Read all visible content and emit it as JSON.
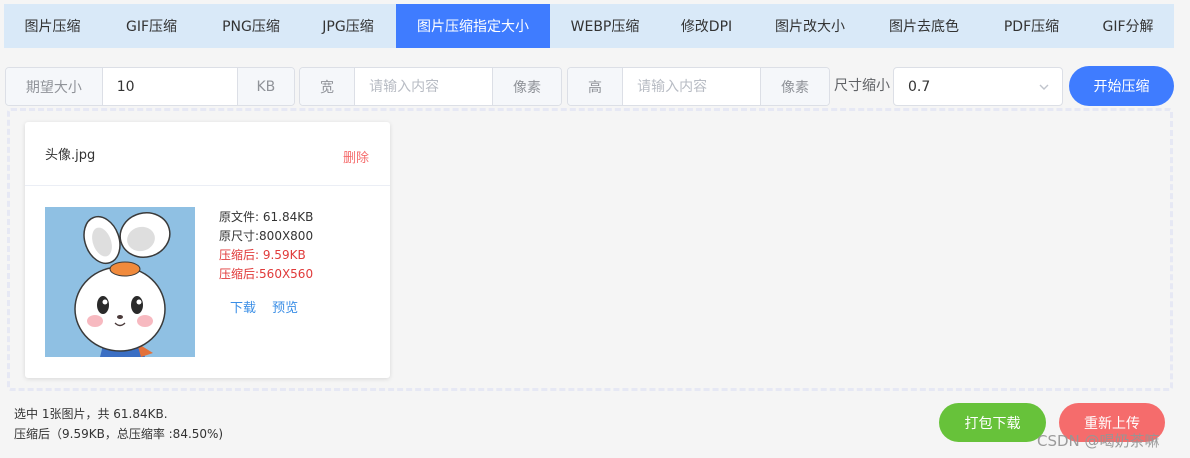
{
  "tabs": [
    {
      "label": "图片压缩"
    },
    {
      "label": "GIF压缩"
    },
    {
      "label": "PNG压缩"
    },
    {
      "label": "JPG压缩"
    },
    {
      "label": "图片压缩指定大小"
    },
    {
      "label": "WEBP压缩"
    },
    {
      "label": "修改DPI"
    },
    {
      "label": "图片改大小"
    },
    {
      "label": "图片去底色"
    },
    {
      "label": "PDF压缩"
    },
    {
      "label": "GIF分解"
    }
  ],
  "active_tab": "图片压缩指定大小",
  "options": {
    "size_label": "期望大小",
    "size_value": "10",
    "size_unit": "KB",
    "width_label": "宽",
    "width_placeholder": "请输入内容",
    "width_unit": "像素",
    "height_label": "高",
    "height_placeholder": "请输入内容",
    "height_unit": "像素",
    "scale_label": "尺寸缩小",
    "scale_value": "0.7",
    "start_button": "开始压缩"
  },
  "file_card": {
    "file_name": "头像.jpg",
    "delete_label": "删除",
    "original_file": "原文件: 61.84KB",
    "original_dims": "原尺寸:800X800",
    "compressed_size": "压缩后: 9.59KB",
    "compressed_dims": "压缩后:560X560",
    "download_label": "下载",
    "preview_label": "预览"
  },
  "footer": {
    "summary_line1": "选中 1张图片，共 61.84KB.",
    "summary_line2": "压缩后（9.59KB，总压缩率 :84.50%)",
    "pack_download": "打包下载",
    "reupload": "重新上传",
    "watermark": "CSDN @喝奶茶嘛"
  },
  "colors": {
    "accent": "#3f7cff",
    "tab_bar": "#d9e9f8",
    "success": "#67c23a",
    "danger": "#f56c6c"
  }
}
